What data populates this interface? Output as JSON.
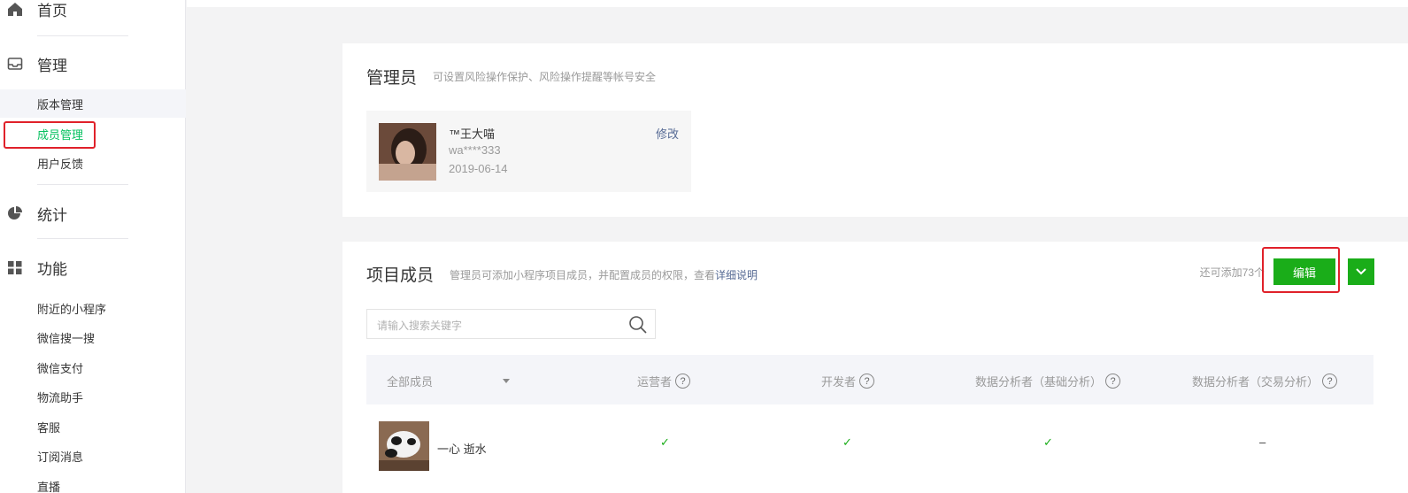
{
  "sidebar": {
    "home_label": "首页",
    "manage_label": "管理",
    "manage_items": [
      "版本管理",
      "成员管理",
      "用户反馈"
    ],
    "stats_label": "统计",
    "features_label": "功能",
    "feature_items": [
      "附近的小程序",
      "微信搜一搜",
      "微信支付",
      "物流助手",
      "客服",
      "订阅消息",
      "直播"
    ]
  },
  "admin": {
    "title": "管理员",
    "desc": "可设置风险操作保护、风险操作提醒等帐号安全",
    "name": "™王大喵",
    "account": "wa****333",
    "date": "2019-06-14",
    "modify_label": "修改"
  },
  "members": {
    "title": "项目成员",
    "desc": "管理员可添加小程序项目成员，并配置成员的权限，查看",
    "desc_link": "详细说明",
    "quota": "还可添加73个",
    "edit_label": "编辑",
    "search_placeholder": "请输入搜索关键字",
    "columns": [
      "全部成员",
      "运营者",
      "开发者",
      "数据分析者（基础分析）",
      "数据分析者（交易分析）"
    ],
    "rows": [
      {
        "name": "一心 逝水",
        "operator": "✓",
        "developer": "✓",
        "basic_analyst": "✓",
        "trade_analyst": "–"
      }
    ]
  },
  "colors": {
    "accent": "#1aad19",
    "highlight": "#e0212a",
    "link": "#576b95"
  }
}
